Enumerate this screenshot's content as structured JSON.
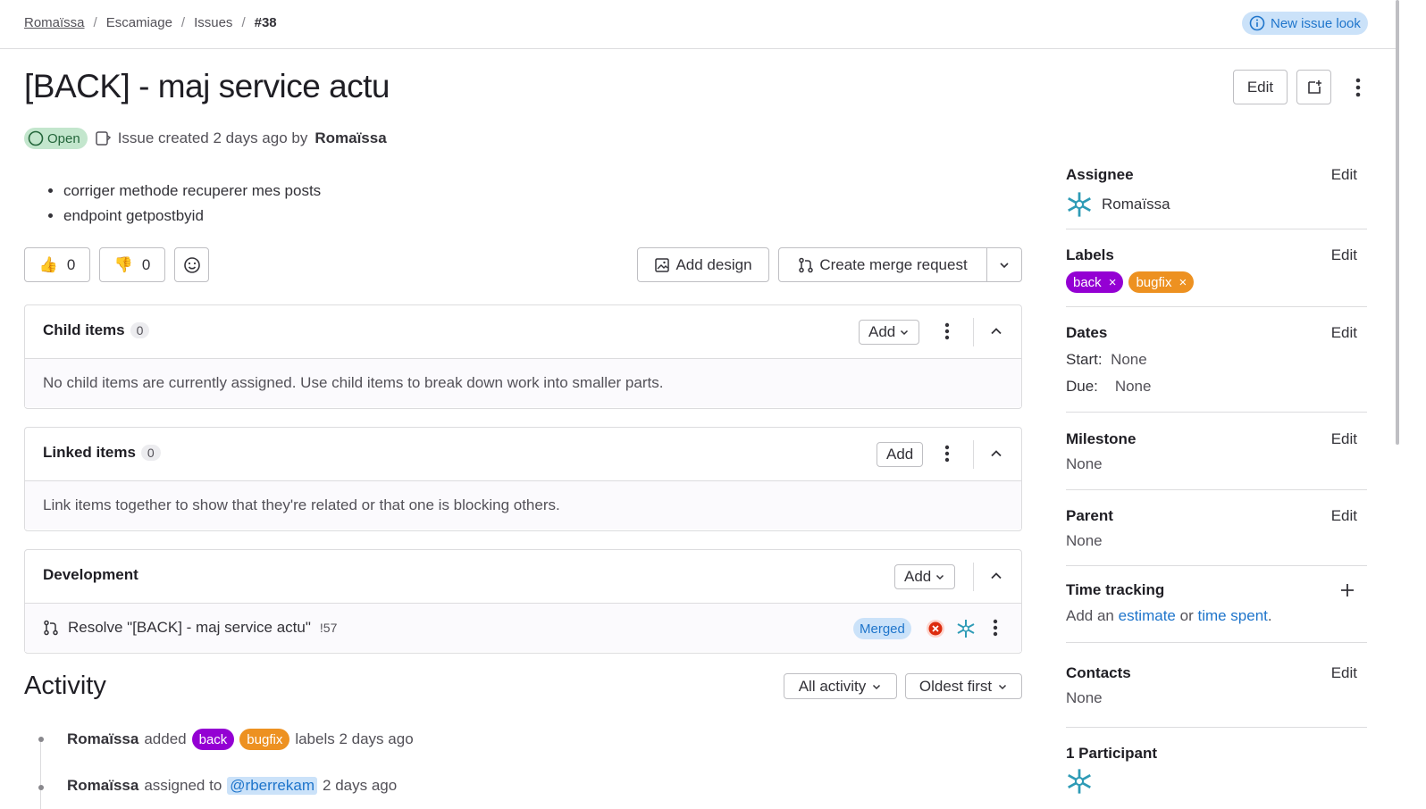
{
  "breadcrumb": [
    "Romaïssa",
    "Escamiage",
    "Issues",
    "#38"
  ],
  "new_issue_look": "New issue look",
  "issue": {
    "title": "[BACK] - maj service actu",
    "status": "Open",
    "meta_prefix": "Issue created 2 days ago by",
    "author": "Romaïssa",
    "edit_label": "Edit",
    "description": [
      "corriger methode recuperer mes posts",
      "endpoint getpostbyid"
    ]
  },
  "reactions": {
    "thumbs_up": "0",
    "thumbs_down": "0"
  },
  "actions": {
    "add_design": "Add design",
    "create_mr": "Create merge request"
  },
  "child_items": {
    "title": "Child items",
    "count": "0",
    "add": "Add",
    "empty": "No child items are currently assigned. Use child items to break down work into smaller parts."
  },
  "linked_items": {
    "title": "Linked items",
    "count": "0",
    "add": "Add",
    "empty": "Link items together to show that they're related or that one is blocking others."
  },
  "development": {
    "title": "Development",
    "add": "Add",
    "mr_title": "Resolve \"[BACK] - maj service actu\"",
    "mr_ref": "!57",
    "mr_status": "Merged"
  },
  "activity": {
    "title": "Activity",
    "filter": "All activity",
    "sort": "Oldest first",
    "items": [
      {
        "user": "Romaïssa",
        "verb": "added",
        "labels": [
          "back",
          "bugfix"
        ],
        "suffix": "labels 2 days ago"
      },
      {
        "user": "Romaïssa",
        "verb": "assigned to",
        "mention": "@rberrekam",
        "suffix": "2 days ago"
      }
    ]
  },
  "sidebar": {
    "edit": "Edit",
    "assignee": {
      "title": "Assignee",
      "name": "Romaïssa"
    },
    "labels": {
      "title": "Labels",
      "items": [
        "back",
        "bugfix"
      ]
    },
    "dates": {
      "title": "Dates",
      "start_label": "Start:",
      "start": "None",
      "due_label": "Due:",
      "due": "None"
    },
    "milestone": {
      "title": "Milestone",
      "value": "None"
    },
    "parent": {
      "title": "Parent",
      "value": "None"
    },
    "time_tracking": {
      "title": "Time tracking",
      "pre": "Add an",
      "estimate": "estimate",
      "or": "or",
      "spent": "time spent",
      "end": "."
    },
    "contacts": {
      "title": "Contacts",
      "value": "None"
    },
    "participants": {
      "title": "1 Participant"
    }
  },
  "colors": {
    "label_back": "#9400d3",
    "label_bugfix": "#ed9121",
    "link": "#1f75cb",
    "open_badge": "#c3e6cd"
  }
}
